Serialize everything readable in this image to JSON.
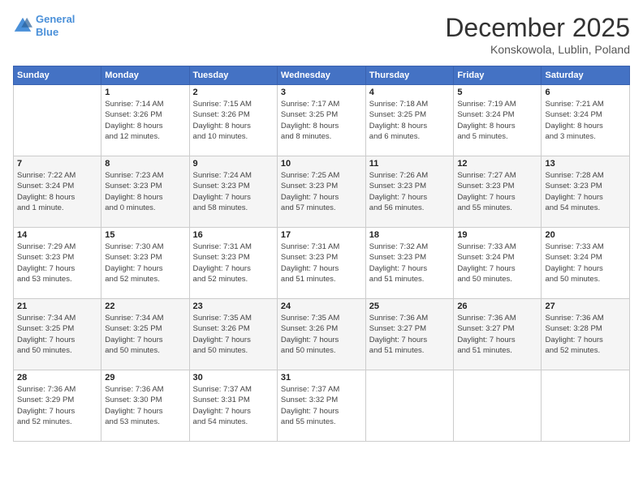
{
  "logo": {
    "line1": "General",
    "line2": "Blue"
  },
  "title": "December 2025",
  "subtitle": "Konskowola, Lublin, Poland",
  "days_header": [
    "Sunday",
    "Monday",
    "Tuesday",
    "Wednesday",
    "Thursday",
    "Friday",
    "Saturday"
  ],
  "weeks": [
    [
      {
        "day": "",
        "info": ""
      },
      {
        "day": "1",
        "info": "Sunrise: 7:14 AM\nSunset: 3:26 PM\nDaylight: 8 hours\nand 12 minutes."
      },
      {
        "day": "2",
        "info": "Sunrise: 7:15 AM\nSunset: 3:26 PM\nDaylight: 8 hours\nand 10 minutes."
      },
      {
        "day": "3",
        "info": "Sunrise: 7:17 AM\nSunset: 3:25 PM\nDaylight: 8 hours\nand 8 minutes."
      },
      {
        "day": "4",
        "info": "Sunrise: 7:18 AM\nSunset: 3:25 PM\nDaylight: 8 hours\nand 6 minutes."
      },
      {
        "day": "5",
        "info": "Sunrise: 7:19 AM\nSunset: 3:24 PM\nDaylight: 8 hours\nand 5 minutes."
      },
      {
        "day": "6",
        "info": "Sunrise: 7:21 AM\nSunset: 3:24 PM\nDaylight: 8 hours\nand 3 minutes."
      }
    ],
    [
      {
        "day": "7",
        "info": "Sunrise: 7:22 AM\nSunset: 3:24 PM\nDaylight: 8 hours\nand 1 minute."
      },
      {
        "day": "8",
        "info": "Sunrise: 7:23 AM\nSunset: 3:23 PM\nDaylight: 8 hours\nand 0 minutes."
      },
      {
        "day": "9",
        "info": "Sunrise: 7:24 AM\nSunset: 3:23 PM\nDaylight: 7 hours\nand 58 minutes."
      },
      {
        "day": "10",
        "info": "Sunrise: 7:25 AM\nSunset: 3:23 PM\nDaylight: 7 hours\nand 57 minutes."
      },
      {
        "day": "11",
        "info": "Sunrise: 7:26 AM\nSunset: 3:23 PM\nDaylight: 7 hours\nand 56 minutes."
      },
      {
        "day": "12",
        "info": "Sunrise: 7:27 AM\nSunset: 3:23 PM\nDaylight: 7 hours\nand 55 minutes."
      },
      {
        "day": "13",
        "info": "Sunrise: 7:28 AM\nSunset: 3:23 PM\nDaylight: 7 hours\nand 54 minutes."
      }
    ],
    [
      {
        "day": "14",
        "info": "Sunrise: 7:29 AM\nSunset: 3:23 PM\nDaylight: 7 hours\nand 53 minutes."
      },
      {
        "day": "15",
        "info": "Sunrise: 7:30 AM\nSunset: 3:23 PM\nDaylight: 7 hours\nand 52 minutes."
      },
      {
        "day": "16",
        "info": "Sunrise: 7:31 AM\nSunset: 3:23 PM\nDaylight: 7 hours\nand 52 minutes."
      },
      {
        "day": "17",
        "info": "Sunrise: 7:31 AM\nSunset: 3:23 PM\nDaylight: 7 hours\nand 51 minutes."
      },
      {
        "day": "18",
        "info": "Sunrise: 7:32 AM\nSunset: 3:23 PM\nDaylight: 7 hours\nand 51 minutes."
      },
      {
        "day": "19",
        "info": "Sunrise: 7:33 AM\nSunset: 3:24 PM\nDaylight: 7 hours\nand 50 minutes."
      },
      {
        "day": "20",
        "info": "Sunrise: 7:33 AM\nSunset: 3:24 PM\nDaylight: 7 hours\nand 50 minutes."
      }
    ],
    [
      {
        "day": "21",
        "info": "Sunrise: 7:34 AM\nSunset: 3:25 PM\nDaylight: 7 hours\nand 50 minutes."
      },
      {
        "day": "22",
        "info": "Sunrise: 7:34 AM\nSunset: 3:25 PM\nDaylight: 7 hours\nand 50 minutes."
      },
      {
        "day": "23",
        "info": "Sunrise: 7:35 AM\nSunset: 3:26 PM\nDaylight: 7 hours\nand 50 minutes."
      },
      {
        "day": "24",
        "info": "Sunrise: 7:35 AM\nSunset: 3:26 PM\nDaylight: 7 hours\nand 50 minutes."
      },
      {
        "day": "25",
        "info": "Sunrise: 7:36 AM\nSunset: 3:27 PM\nDaylight: 7 hours\nand 51 minutes."
      },
      {
        "day": "26",
        "info": "Sunrise: 7:36 AM\nSunset: 3:27 PM\nDaylight: 7 hours\nand 51 minutes."
      },
      {
        "day": "27",
        "info": "Sunrise: 7:36 AM\nSunset: 3:28 PM\nDaylight: 7 hours\nand 52 minutes."
      }
    ],
    [
      {
        "day": "28",
        "info": "Sunrise: 7:36 AM\nSunset: 3:29 PM\nDaylight: 7 hours\nand 52 minutes."
      },
      {
        "day": "29",
        "info": "Sunrise: 7:36 AM\nSunset: 3:30 PM\nDaylight: 7 hours\nand 53 minutes."
      },
      {
        "day": "30",
        "info": "Sunrise: 7:37 AM\nSunset: 3:31 PM\nDaylight: 7 hours\nand 54 minutes."
      },
      {
        "day": "31",
        "info": "Sunrise: 7:37 AM\nSunset: 3:32 PM\nDaylight: 7 hours\nand 55 minutes."
      },
      {
        "day": "",
        "info": ""
      },
      {
        "day": "",
        "info": ""
      },
      {
        "day": "",
        "info": ""
      }
    ]
  ]
}
